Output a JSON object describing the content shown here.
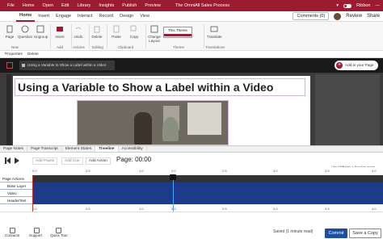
{
  "titlebar": {
    "app_title": "The OmniAll Sales Process",
    "menus": [
      "File",
      "Home",
      "Open",
      "Edit",
      "Library",
      "Insights",
      "Publish",
      "Preview"
    ],
    "ribbon_toggle_label": "Ribbon"
  },
  "ribbon_tabs": {
    "items": [
      "Home",
      "Insert",
      "Engage",
      "Interact",
      "Record",
      "Design",
      "View"
    ],
    "active": "Home",
    "comments_label": "Comments (0)",
    "review_label": "Review",
    "share_label": "Share"
  },
  "ribbon": {
    "buttons": [
      "Page",
      "Question",
      "Ungroup",
      "Undo",
      "Insert",
      "Delete",
      "Copy",
      "Paste",
      "Change Layout",
      "Translate"
    ],
    "groups": [
      "New",
      "Add",
      "Actions",
      "Editing",
      "Clipboard",
      "Theme",
      "Translations"
    ],
    "theme_name": "This Theme"
  },
  "propbar": {
    "properties_label": "Properties",
    "delete_label": "Delete"
  },
  "page_tab": {
    "label": "Using a Variable to Show a Label within a Video",
    "add_page_label": "Add to your Page"
  },
  "slide": {
    "title": "Using a Variable to Show a Label within a Video"
  },
  "bottom_tabs": {
    "items": [
      "Page Notes",
      "Page Transcript",
      "Element States",
      "Timeline",
      "Accessibility"
    ],
    "active": "Timeline"
  },
  "timeline": {
    "add_pause": "Add Pause",
    "add_cue": "Add Cue",
    "add_action": "Add Action",
    "page_time": "Page: 00:00",
    "hint": "Use Shift Key + Scroll to zoom",
    "ticks": [
      "0.0",
      "0.5",
      "1.0",
      "1.5",
      "2.0",
      "2.5",
      "3.0",
      "3.5",
      "4.0",
      "4.5"
    ],
    "tracks": [
      "Page Actions",
      "Base Layer",
      "Video",
      "HeaderText"
    ]
  },
  "status": {
    "items": [
      "Contacts",
      "Support",
      "Quick Tour"
    ],
    "saved": "Saved (1 minute read)",
    "commit_label": "Commit",
    "save_copy_label": "Save a Copy"
  },
  "colors": {
    "brand": "#9b1b30",
    "timeline_track": "#1e3b8a",
    "commit": "#1f4e9c",
    "playhead": "#4aa3ff"
  }
}
